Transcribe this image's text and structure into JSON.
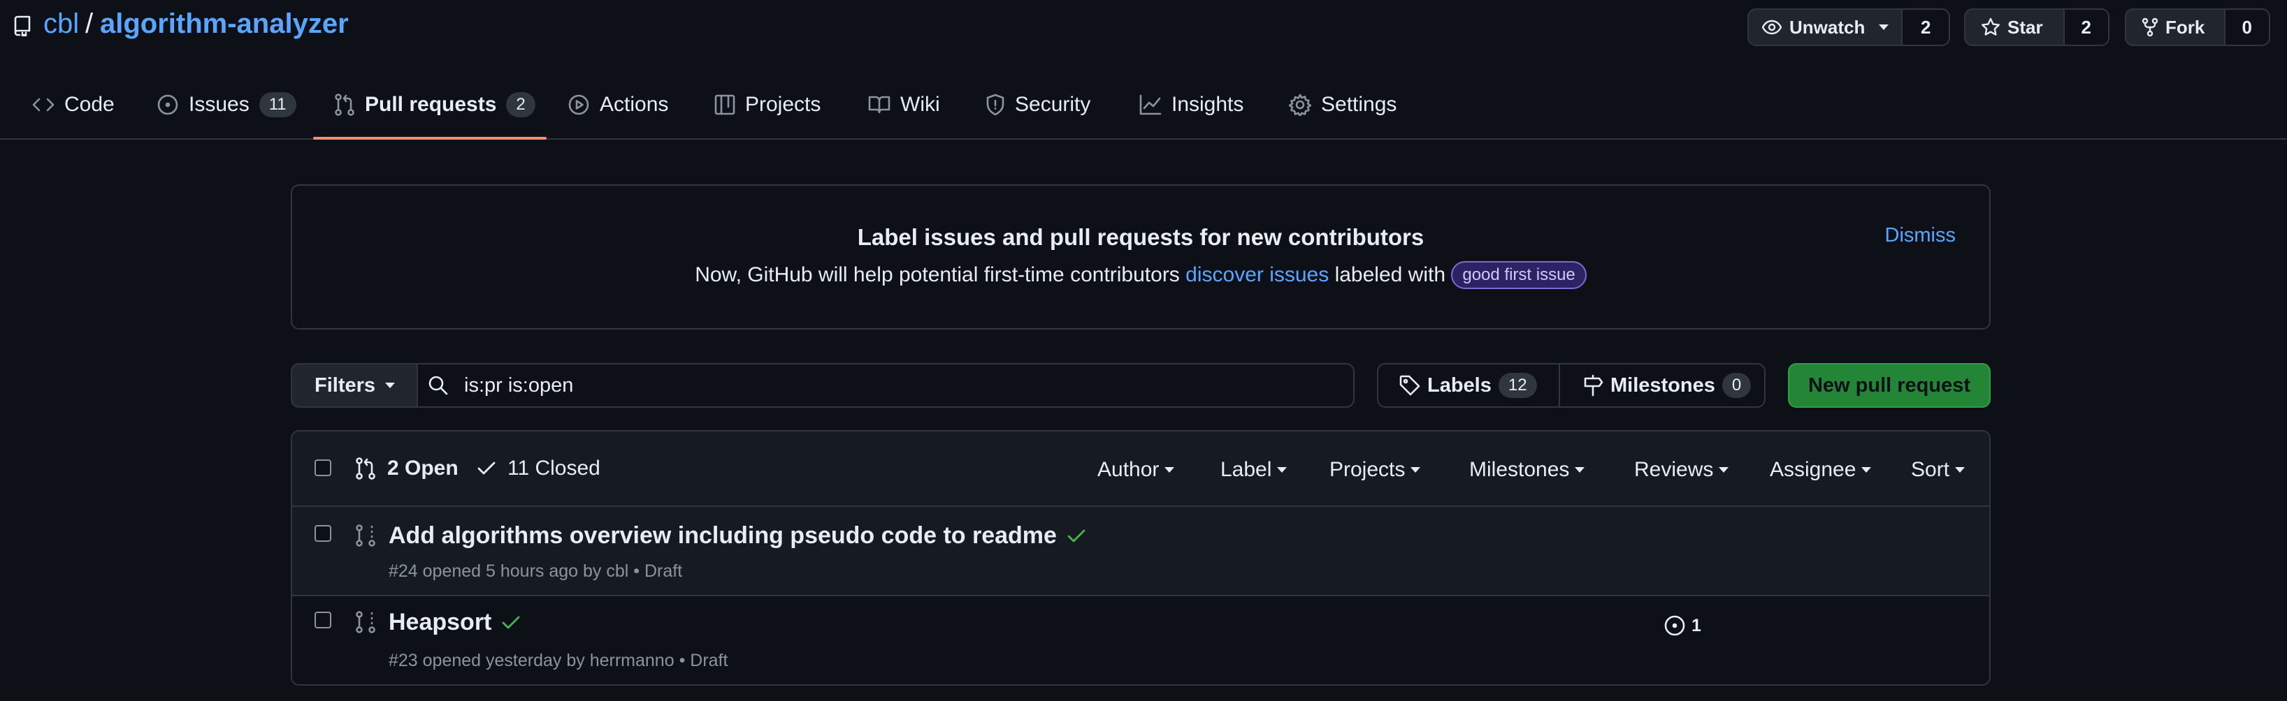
{
  "repo": {
    "owner": "cbl",
    "separator": "/",
    "name": "algorithm-analyzer"
  },
  "header_buttons": {
    "unwatch": {
      "label": "Unwatch",
      "count": "2"
    },
    "star": {
      "label": "Star",
      "count": "2"
    },
    "fork": {
      "label": "Fork",
      "count": "0"
    }
  },
  "tabs": [
    {
      "label": "Code",
      "icon": "code-icon"
    },
    {
      "label": "Issues",
      "icon": "issue-icon",
      "count": "11"
    },
    {
      "label": "Pull requests",
      "icon": "pull-request-icon",
      "count": "2",
      "selected": true
    },
    {
      "label": "Actions",
      "icon": "play-icon"
    },
    {
      "label": "Projects",
      "icon": "table-icon"
    },
    {
      "label": "Wiki",
      "icon": "book-icon"
    },
    {
      "label": "Security",
      "icon": "shield-icon"
    },
    {
      "label": "Insights",
      "icon": "graph-icon"
    },
    {
      "label": "Settings",
      "icon": "gear-icon"
    }
  ],
  "banner": {
    "title": "Label issues and pull requests for new contributors",
    "text_before": "Now, GitHub will help potential first-time contributors",
    "link": "discover issues",
    "text_after": "labeled with",
    "label": "good first issue",
    "dismiss": "Dismiss"
  },
  "filterbar": {
    "filters": "Filters",
    "search_value": "is:pr is:open",
    "labels": "Labels",
    "labels_count": "12",
    "milestones": "Milestones",
    "milestones_count": "0",
    "new_pr": "New pull request"
  },
  "list": {
    "open": "2 Open",
    "closed": "11 Closed",
    "dropdowns": [
      "Author",
      "Label",
      "Projects",
      "Milestones",
      "Reviews",
      "Assignee",
      "Sort"
    ],
    "items": [
      {
        "title": "Add algorithms overview including pseudo code to readme",
        "meta": "#24 opened 5 hours ago by cbl",
        "status": "Draft",
        "check": "passing"
      },
      {
        "title": "Heapsort",
        "meta": "#23 opened yesterday by herrmanno",
        "status": "Draft",
        "check": "passing",
        "comments": "1"
      }
    ]
  },
  "colors": {
    "accent": "#58a6ff",
    "success": "#3fb950",
    "tab_underline": "#fd8c73",
    "primary_button": "#238636",
    "background": "#0d1117"
  }
}
